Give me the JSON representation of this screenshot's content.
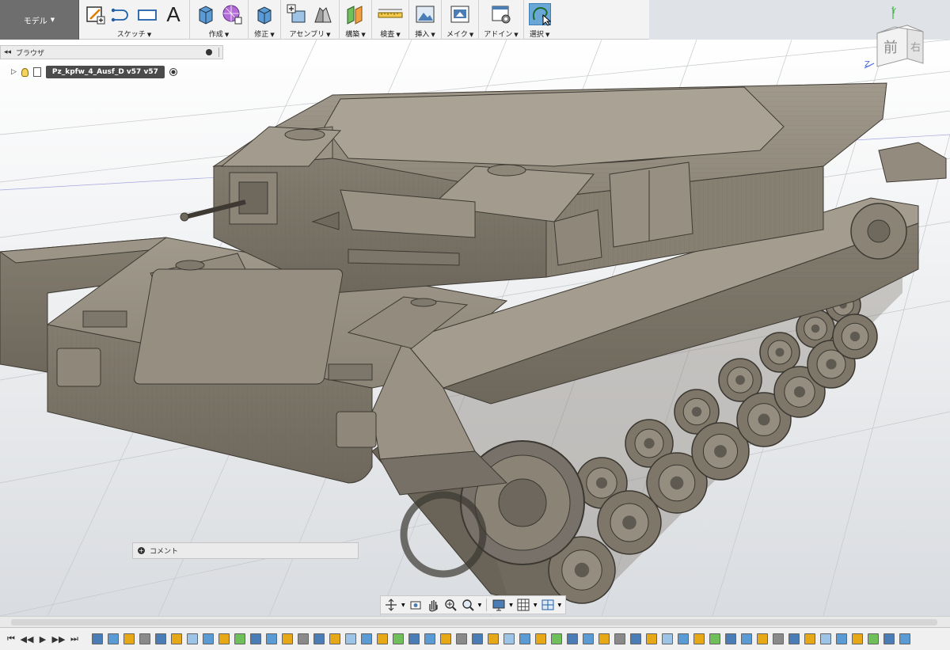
{
  "workspace": {
    "label": "モデル"
  },
  "toolbar": {
    "groups": [
      {
        "name": "sketch",
        "label": "スケッチ"
      },
      {
        "name": "create",
        "label": "作成"
      },
      {
        "name": "modify",
        "label": "修正"
      },
      {
        "name": "assemble",
        "label": "アセンブリ"
      },
      {
        "name": "construct",
        "label": "構築"
      },
      {
        "name": "inspect",
        "label": "検査"
      },
      {
        "name": "insert",
        "label": "挿入"
      },
      {
        "name": "make",
        "label": "メイク"
      },
      {
        "name": "addins",
        "label": "アドイン"
      },
      {
        "name": "select",
        "label": "選択"
      }
    ],
    "text_tool_glyph": "A"
  },
  "browser": {
    "title": "ブラウザ",
    "document_name": "Pz_kpfw_4_Ausf_D v57 v57"
  },
  "viewcube": {
    "front": "前",
    "right": "右",
    "axis_y": "Y",
    "axis_z": "Z"
  },
  "comment": {
    "label": "コメント"
  },
  "colors": {
    "toolbar_bg": "#f3f3f3",
    "workspace_bg": "#6e6e6e",
    "model_gray": "#8e877a",
    "grid": "#c9ccd0",
    "select_accent": "#6aa7d6"
  }
}
